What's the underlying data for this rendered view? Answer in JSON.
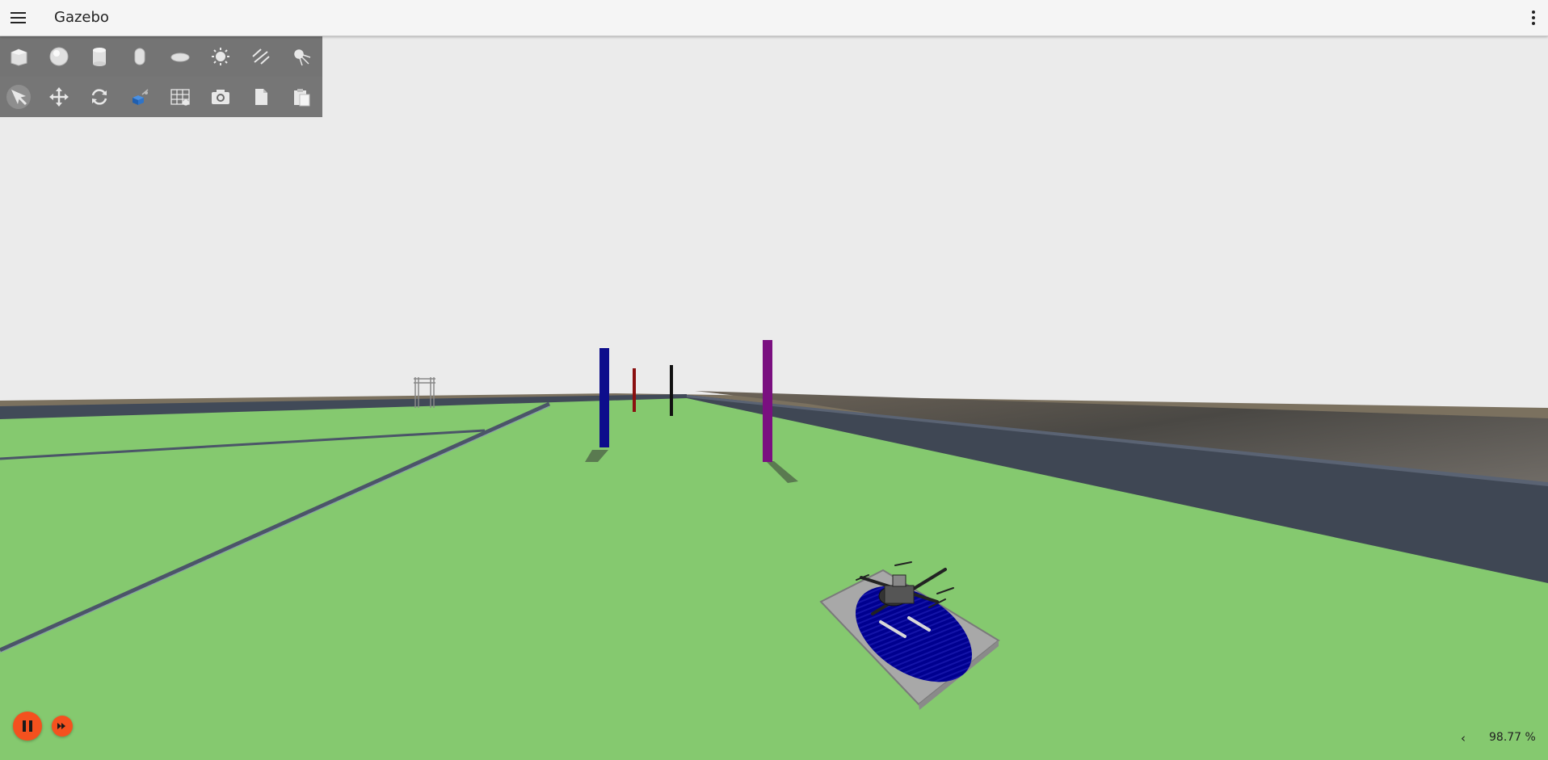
{
  "app": {
    "title": "Gazebo"
  },
  "header": {
    "menu_icon": "hamburger-menu-icon",
    "more_icon": "vertical-dots-icon"
  },
  "toolbar": {
    "row1": [
      {
        "name": "box-shape-icon",
        "label": "Box"
      },
      {
        "name": "sphere-shape-icon",
        "label": "Sphere"
      },
      {
        "name": "cylinder-shape-icon",
        "label": "Cylinder"
      },
      {
        "name": "capsule-shape-icon",
        "label": "Capsule"
      },
      {
        "name": "ellipsoid-shape-icon",
        "label": "Ellipsoid"
      },
      {
        "name": "point-light-icon",
        "label": "Point light"
      },
      {
        "name": "directional-light-icon",
        "label": "Directional light"
      },
      {
        "name": "spot-light-icon",
        "label": "Spot light"
      }
    ],
    "row2": [
      {
        "name": "select-mode-icon",
        "label": "Select",
        "active": true
      },
      {
        "name": "translate-mode-icon",
        "label": "Translate"
      },
      {
        "name": "rotate-mode-icon",
        "label": "Rotate"
      },
      {
        "name": "view-angle-icon",
        "label": "View angle"
      },
      {
        "name": "grid-config-icon",
        "label": "Grid"
      },
      {
        "name": "screenshot-icon",
        "label": "Screenshot"
      },
      {
        "name": "copy-icon",
        "label": "Copy"
      },
      {
        "name": "paste-icon",
        "label": "Paste"
      }
    ]
  },
  "playback": {
    "pause_icon": "pause-icon",
    "step_icon": "step-forward-icon",
    "paused": false
  },
  "stats": {
    "toggle": "‹",
    "real_time_factor": "98.77 %"
  },
  "scene": {
    "sky_color": "#ebebeb",
    "ground_color": "#85c96f",
    "wall_color": "#3f4754",
    "pole_colors": [
      "#0d0d8c",
      "#8a1010",
      "#111111",
      "#7a0f80"
    ],
    "landing_pad_color": "#00008f"
  }
}
